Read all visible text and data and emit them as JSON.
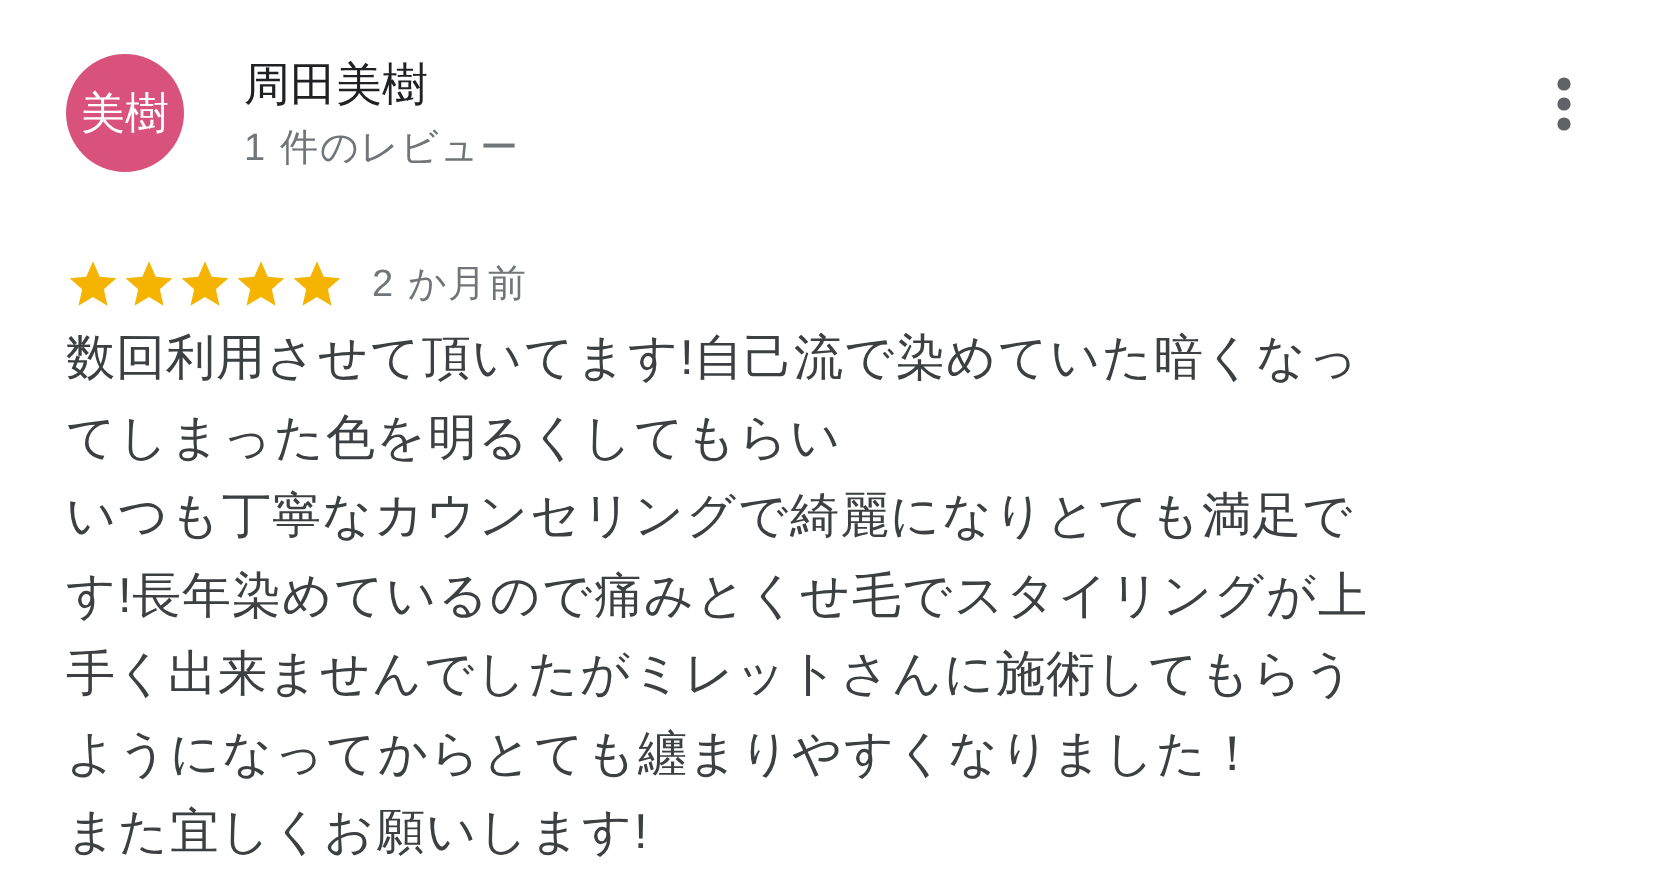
{
  "review": {
    "avatar_text": "美樹",
    "author": "周田美樹",
    "review_count": "1 件のレビュー",
    "stars": 5,
    "time": "2 か月前",
    "body_lines": [
      "数回利用させて頂いてます!自己流で染めていた暗くなっ",
      "てしまった色を明るくしてもらい",
      "いつも丁寧なカウンセリングで綺麗になりとても満足で",
      "す!長年染めているので痛みとくせ毛でスタイリングが上",
      "手く出来ませんでしたがミレットさんに施術してもらう",
      "ようになってからとても纏まりやすくなりました！",
      "また宜しくお願いします!"
    ]
  }
}
